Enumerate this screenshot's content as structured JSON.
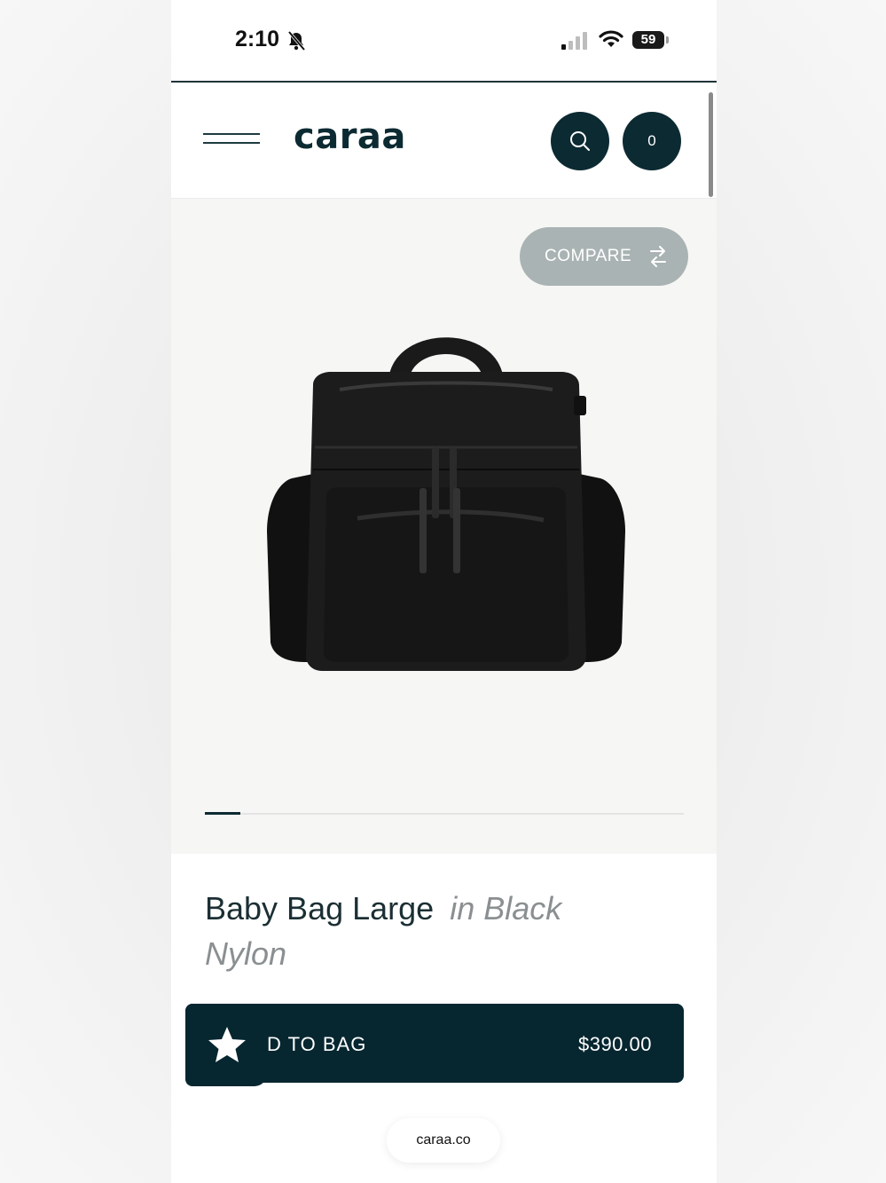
{
  "status_bar": {
    "time": "2:10",
    "battery": "59"
  },
  "header": {
    "brand": "caraa",
    "cart_count": "0"
  },
  "gallery": {
    "compare_label": "COMPARE",
    "current_image": 1
  },
  "product": {
    "name": "Baby Bag Large",
    "variant_line1": "in Black",
    "variant_line2": "Nylon"
  },
  "cta": {
    "label": "D TO BAG",
    "price": "$390.00"
  },
  "browser": {
    "url": "caraa.co"
  },
  "colors": {
    "brand_dark": "#0c2a32",
    "compare_bg": "#aab3b3",
    "gallery_bg": "#f6f6f4"
  }
}
